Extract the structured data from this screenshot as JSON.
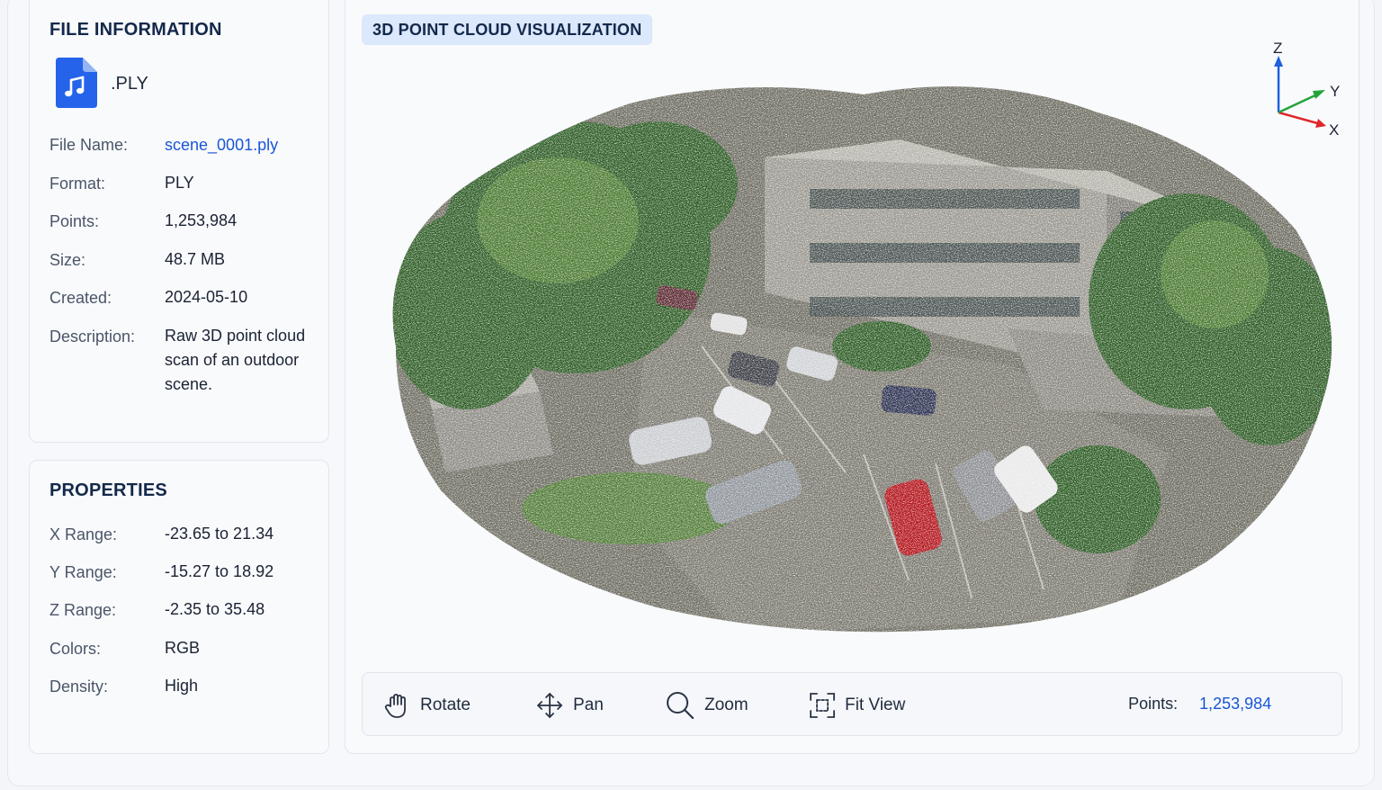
{
  "file_info": {
    "title": "FILE INFORMATION",
    "extension": ".PLY",
    "rows": [
      {
        "label": "File Name:",
        "value": "scene_0001.ply"
      },
      {
        "label": "Format:",
        "value": "PLY"
      },
      {
        "label": "Points:",
        "value": "1,253,984"
      },
      {
        "label": "Size:",
        "value": "48.7 MB"
      },
      {
        "label": "Created:",
        "value": "2024-05-10"
      },
      {
        "label": "Description:",
        "value": "Raw 3D point cloud scan of an outdoor scene."
      }
    ]
  },
  "properties": {
    "title": "PROPERTIES",
    "rows": [
      {
        "label": "X Range:",
        "value": "-23.65 to 21.34"
      },
      {
        "label": "Y Range:",
        "value": "-15.27 to 18.92"
      },
      {
        "label": "Z Range:",
        "value": "-2.35 to 35.48"
      },
      {
        "label": "Colors:",
        "value": "RGB"
      },
      {
        "label": "Density:",
        "value": "High"
      }
    ]
  },
  "viewer": {
    "title": "3D POINT CLOUD VISUALIZATION",
    "axes": {
      "x": "X",
      "y": "Y",
      "z": "Z",
      "x_color": "#e0262a",
      "y_color": "#22a33a",
      "z_color": "#1f5fe0"
    },
    "toolbar": {
      "rotate": "Rotate",
      "pan": "Pan",
      "zoom": "Zoom",
      "fit": "Fit View",
      "points_label": "Points:",
      "points_value": "1,253,984"
    }
  },
  "colors": {
    "accent": "#1a56d6",
    "title": "#13294b",
    "tag_bg": "#dce8fb"
  }
}
